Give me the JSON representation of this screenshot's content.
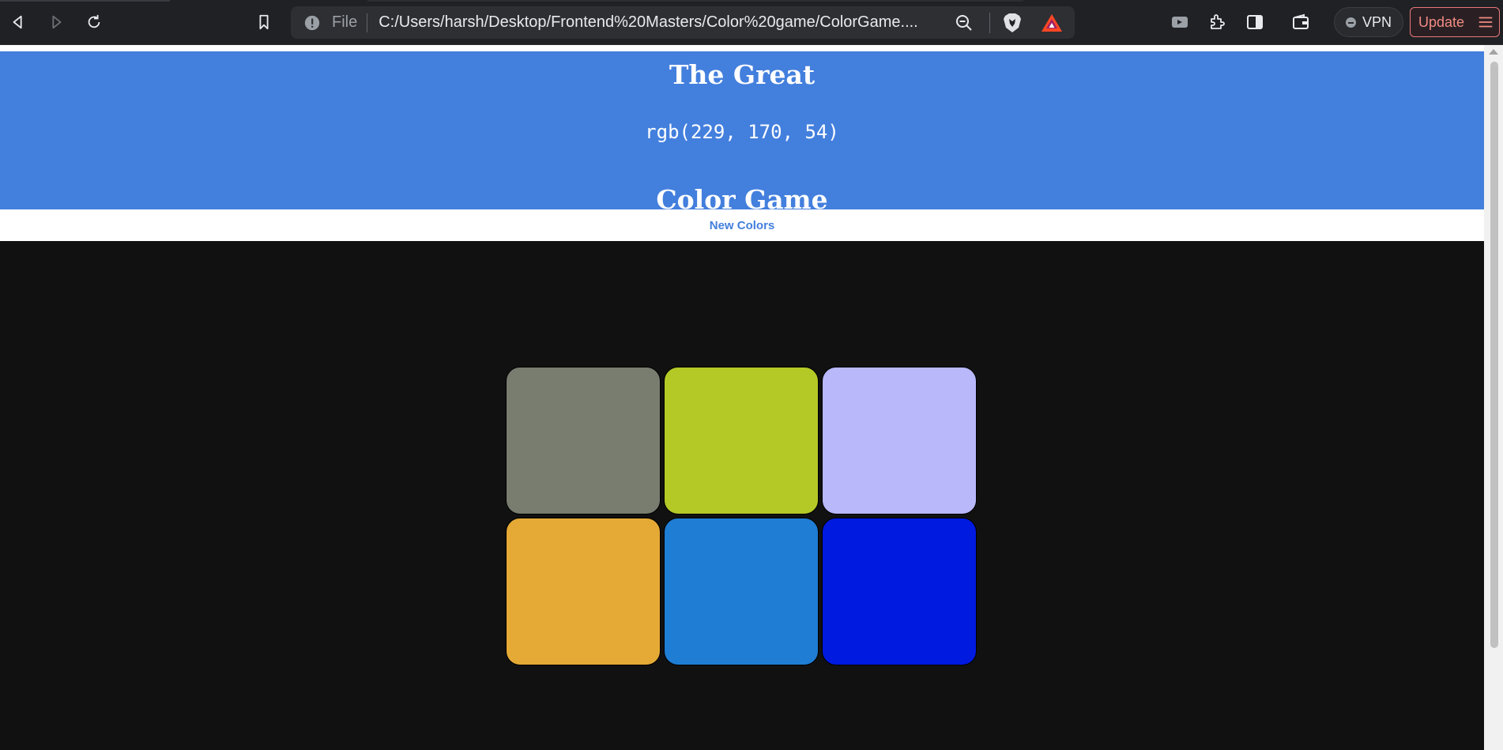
{
  "browser": {
    "url_scheme_label": "File",
    "url": "C:/Users/harsh/Desktop/Frontend%20Masters/Color%20game/ColorGame....",
    "vpn_label": "VPN",
    "update_label": "Update",
    "icons": [
      "back-icon",
      "forward-icon",
      "reload-icon",
      "bookmark-icon",
      "info-icon",
      "zoom-out-icon",
      "brave-shields-icon",
      "brave-rewards-icon",
      "media-icon",
      "extensions-icon",
      "sidebar-icon",
      "wallet-icon",
      "menu-icon"
    ]
  },
  "game": {
    "title_top": "The Great",
    "target_rgb": "rgb(229, 170, 54)",
    "title_bottom": "Color Game",
    "new_colors_label": "New Colors",
    "header_color": "#437fdd",
    "squares": [
      {
        "color": "#797d6f"
      },
      {
        "color": "#b4c926"
      },
      {
        "color": "#b8b8fb"
      },
      {
        "color": "#e5aa36"
      },
      {
        "color": "#1f7dd4"
      },
      {
        "color": "#001adf"
      }
    ]
  }
}
